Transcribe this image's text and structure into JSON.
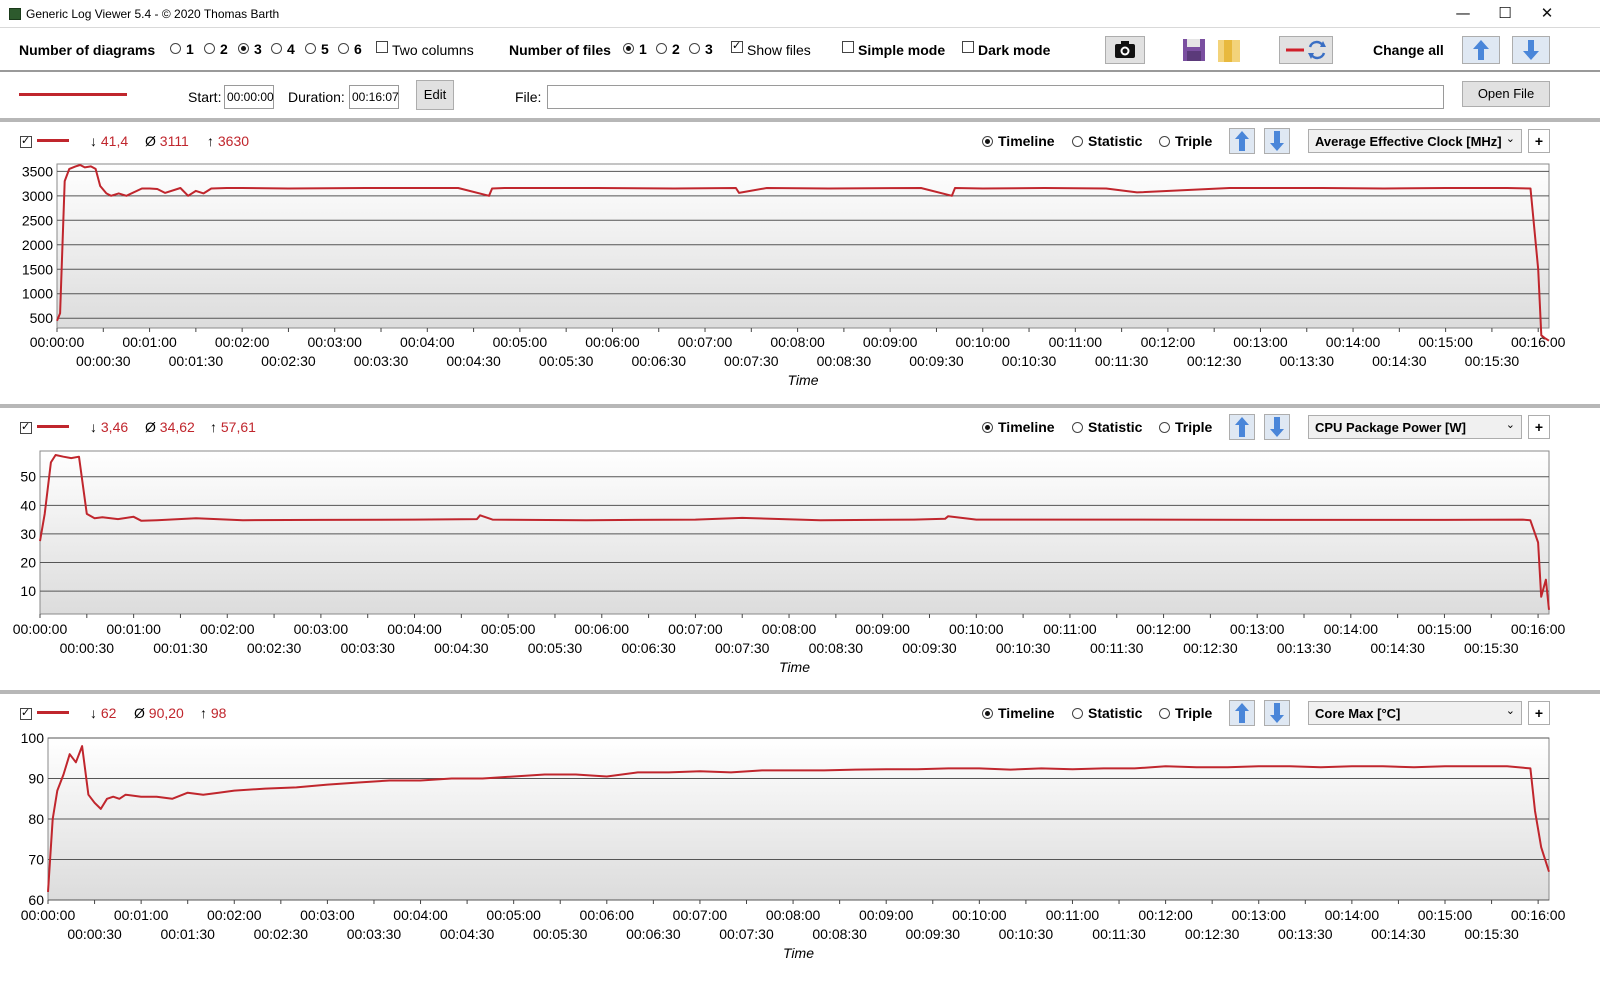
{
  "window": {
    "title": "Generic Log Viewer 5.4 - © 2020 Thomas Barth",
    "minimize": "—",
    "maximize": "☐",
    "close": "✕"
  },
  "toolbar": {
    "num_diagrams_label": "Number of diagrams",
    "diagram_options": [
      "1",
      "2",
      "3",
      "4",
      "5",
      "6"
    ],
    "diagram_selected": "3",
    "two_columns_label": "Two columns",
    "num_files_label": "Number of files",
    "file_options": [
      "1",
      "2",
      "3"
    ],
    "file_selected": "1",
    "show_files_label": "Show files",
    "simple_mode_label": "Simple mode",
    "dark_mode_label": "Dark mode",
    "change_all_label": "Change all"
  },
  "file_row": {
    "start_label": "Start:",
    "start_value": "00:00:00",
    "duration_label": "Duration:",
    "duration_value": "00:16:07",
    "edit_label": "Edit",
    "file_label": "File:",
    "open_file_label": "Open File"
  },
  "colors": {
    "series": "#c0262d",
    "grid": "#7a7a7a"
  },
  "panels": [
    {
      "stats": {
        "min": "41,4",
        "avg": "3111",
        "max": "3630"
      },
      "option_labels": [
        "Timeline",
        "Statistic",
        "Triple"
      ],
      "selected_option": "Timeline",
      "sensor": "Average Effective Clock [MHz]",
      "xlabel": "Time"
    },
    {
      "stats": {
        "min": "3,46",
        "avg": "34,62",
        "max": "57,61"
      },
      "option_labels": [
        "Timeline",
        "Statistic",
        "Triple"
      ],
      "selected_option": "Timeline",
      "sensor": "CPU Package Power [W]",
      "xlabel": "Time"
    },
    {
      "stats": {
        "min": "62",
        "avg": "90,20",
        "max": "98"
      },
      "option_labels": [
        "Timeline",
        "Statistic",
        "Triple"
      ],
      "selected_option": "Timeline",
      "sensor": "Core Max [°C]",
      "xlabel": "Time"
    }
  ],
  "chart_data": [
    {
      "type": "line",
      "title": "",
      "xlabel": "Time",
      "ylabel": "",
      "ylim": [
        300,
        3650
      ],
      "yticks": [
        "500",
        "1000",
        "1500",
        "2000",
        "2500",
        "3000",
        "3500"
      ],
      "xticks_top": [
        "00:00:00",
        "00:01:00",
        "00:02:00",
        "00:03:00",
        "00:04:00",
        "00:05:00",
        "00:06:00",
        "00:07:00",
        "00:08:00",
        "00:09:00",
        "00:10:00",
        "00:11:00",
        "00:12:00",
        "00:13:00",
        "00:14:00",
        "00:15:00",
        "00:16:00"
      ],
      "xticks_bottom": [
        "00:00:30",
        "00:01:30",
        "00:02:30",
        "00:03:30",
        "00:04:30",
        "00:05:30",
        "00:06:30",
        "00:07:30",
        "00:08:30",
        "00:09:30",
        "00:10:30",
        "00:11:30",
        "00:12:30",
        "00:13:30",
        "00:14:30",
        "00:15:30"
      ],
      "series": [
        {
          "x": [
            0,
            2,
            5,
            8,
            12,
            15,
            18,
            22,
            25,
            28,
            32,
            35,
            40,
            45,
            55,
            60,
            65,
            70,
            80,
            85,
            90,
            95,
            100,
            110,
            120,
            150,
            200,
            260,
            280,
            282,
            290,
            350,
            400,
            440,
            442,
            460,
            500,
            560,
            580,
            582,
            600,
            640,
            680,
            700,
            760,
            820,
            860,
            900,
            940,
            955,
            960,
            962,
            964,
            967
          ],
          "y": [
            450,
            600,
            3300,
            3550,
            3600,
            3630,
            3580,
            3600,
            3550,
            3200,
            3050,
            3000,
            3050,
            3000,
            3150,
            3150,
            3140,
            3060,
            3160,
            3000,
            3100,
            3050,
            3150,
            3160,
            3160,
            3150,
            3160,
            3160,
            3000,
            3150,
            3160,
            3160,
            3150,
            3160,
            3060,
            3160,
            3150,
            3160,
            3000,
            3160,
            3150,
            3160,
            3150,
            3070,
            3160,
            3160,
            3150,
            3160,
            3160,
            3150,
            1500,
            150,
            100,
            41.4
          ]
        }
      ]
    },
    {
      "type": "line",
      "title": "",
      "xlabel": "Time",
      "ylabel": "",
      "ylim": [
        2,
        59
      ],
      "yticks": [
        "10",
        "20",
        "30",
        "40",
        "50"
      ],
      "xticks_top": [
        "00:00:00",
        "00:01:00",
        "00:02:00",
        "00:03:00",
        "00:04:00",
        "00:05:00",
        "00:06:00",
        "00:07:00",
        "00:08:00",
        "00:09:00",
        "00:10:00",
        "00:11:00",
        "00:12:00",
        "00:13:00",
        "00:14:00",
        "00:15:00",
        "00:16:00"
      ],
      "xticks_bottom": [
        "00:00:30",
        "00:01:30",
        "00:02:30",
        "00:03:30",
        "00:04:30",
        "00:05:30",
        "00:06:30",
        "00:07:30",
        "00:08:30",
        "00:09:30",
        "00:10:30",
        "00:11:30",
        "00:12:30",
        "00:13:30",
        "00:14:30",
        "00:15:30"
      ],
      "series": [
        {
          "x": [
            0,
            3,
            7,
            10,
            15,
            20,
            25,
            30,
            35,
            40,
            50,
            60,
            65,
            75,
            100,
            130,
            180,
            240,
            280,
            282,
            290,
            350,
            420,
            450,
            500,
            560,
            580,
            582,
            600,
            700,
            800,
            900,
            950,
            955,
            960,
            962,
            964,
            965,
            967
          ],
          "y": [
            27.5,
            37,
            55,
            57.6,
            57,
            56.5,
            57,
            37,
            35.5,
            35.8,
            35.2,
            36,
            34.6,
            34.8,
            35.5,
            34.8,
            34.9,
            35,
            35.2,
            36.5,
            35,
            34.8,
            35,
            35.6,
            34.8,
            35,
            35.3,
            36.2,
            35,
            35,
            34.9,
            34.9,
            35,
            34.8,
            27,
            8,
            12,
            14,
            3.46
          ]
        }
      ]
    },
    {
      "type": "line",
      "title": "",
      "xlabel": "Time",
      "ylabel": "",
      "ylim": [
        60,
        100
      ],
      "yticks": [
        "60",
        "70",
        "80",
        "90",
        "100"
      ],
      "xticks_top": [
        "00:00:00",
        "00:01:00",
        "00:02:00",
        "00:03:00",
        "00:04:00",
        "00:05:00",
        "00:06:00",
        "00:07:00",
        "00:08:00",
        "00:09:00",
        "00:10:00",
        "00:11:00",
        "00:12:00",
        "00:13:00",
        "00:14:00",
        "00:15:00",
        "00:16:00"
      ],
      "xticks_bottom": [
        "00:00:30",
        "00:01:30",
        "00:02:30",
        "00:03:30",
        "00:04:30",
        "00:05:30",
        "00:06:30",
        "00:07:30",
        "00:08:30",
        "00:09:30",
        "00:10:30",
        "00:11:30",
        "00:12:30",
        "00:13:30",
        "00:14:30",
        "00:15:30"
      ],
      "series": [
        {
          "x": [
            0,
            3,
            6,
            10,
            14,
            18,
            22,
            26,
            30,
            34,
            38,
            42,
            46,
            50,
            60,
            70,
            80,
            90,
            100,
            110,
            120,
            140,
            160,
            180,
            200,
            220,
            240,
            260,
            280,
            300,
            320,
            340,
            360,
            380,
            400,
            420,
            440,
            460,
            480,
            500,
            520,
            540,
            560,
            580,
            600,
            620,
            640,
            660,
            680,
            700,
            720,
            740,
            760,
            780,
            800,
            820,
            840,
            860,
            880,
            900,
            920,
            940,
            955,
            958,
            962,
            967
          ],
          "y": [
            62,
            80,
            87,
            91,
            96,
            94,
            98,
            86,
            84,
            82.5,
            85,
            85.5,
            85,
            86,
            85.5,
            85.5,
            85,
            86.5,
            86,
            86.5,
            87,
            87.5,
            87.8,
            88.5,
            89,
            89.5,
            89.5,
            90,
            90,
            90.5,
            91,
            91,
            90.5,
            91.5,
            91.5,
            91.8,
            91.5,
            92,
            92,
            92,
            92.2,
            92.3,
            92.3,
            92.5,
            92.5,
            92.2,
            92.5,
            92.3,
            92.5,
            92.5,
            93,
            92.8,
            92.8,
            93,
            93,
            92.8,
            93,
            93,
            92.8,
            93,
            93,
            93,
            92.5,
            82,
            73,
            67
          ]
        }
      ]
    }
  ]
}
